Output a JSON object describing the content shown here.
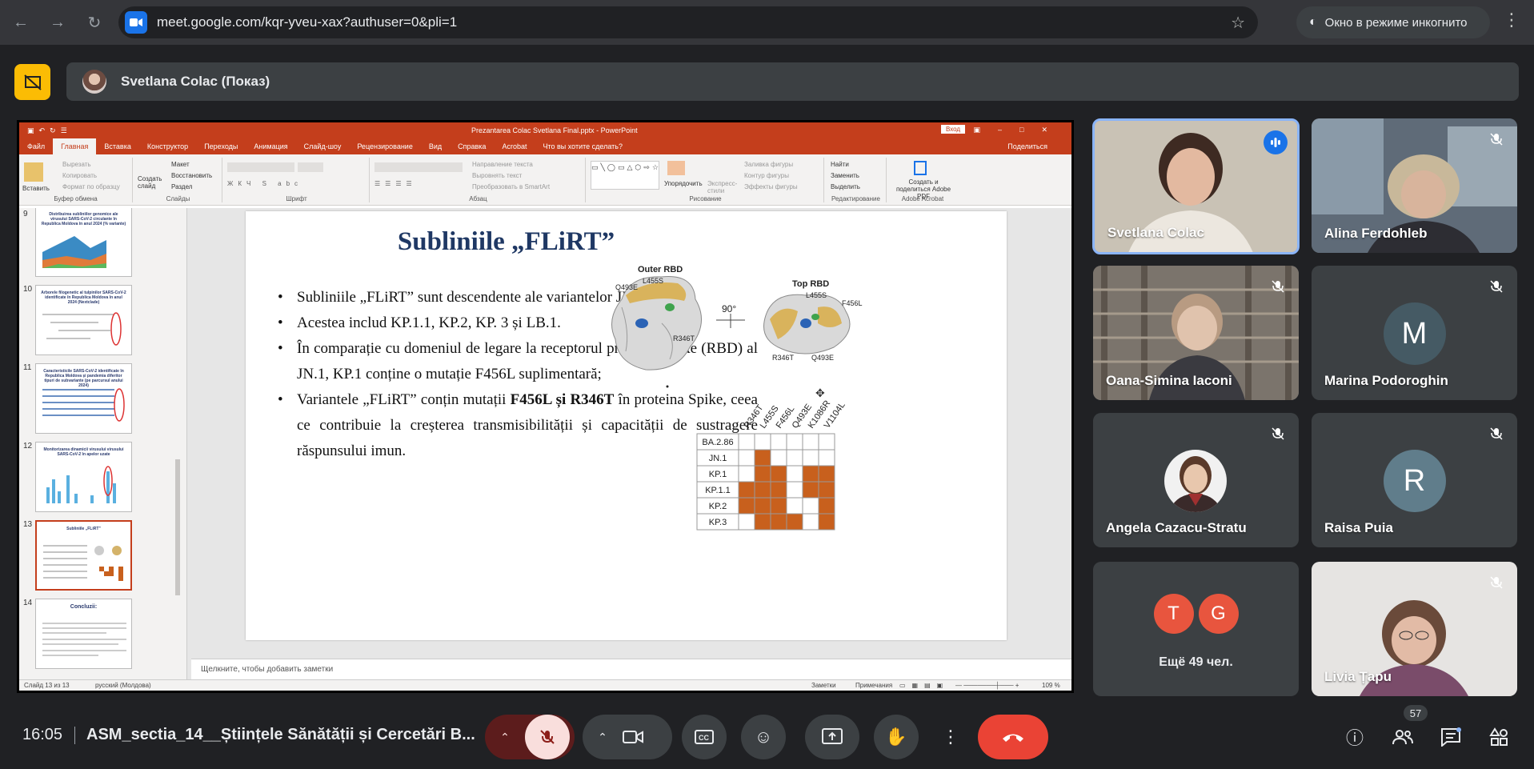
{
  "browser": {
    "url": "meet.google.com/kqr-yveu-xax?authuser=0&pli=1",
    "incognito_label": "Окно в режиме инкогнито"
  },
  "presenter": {
    "label": "Svetlana Colac (Показ)"
  },
  "ppt": {
    "doc_title": "Prezantarea Colac Svetlana Final.pptx - PowerPoint",
    "login_label": "Вход",
    "tabs": [
      "Файл",
      "Главная",
      "Вставка",
      "Конструктор",
      "Переходы",
      "Анимация",
      "Слайд-шоу",
      "Рецензирование",
      "Вид",
      "Справка",
      "Acrobat",
      "Что вы хотите сделать?"
    ],
    "share_label": "Поделиться",
    "groups": {
      "clipboard": {
        "label": "Буфер обмена",
        "paste": "Вставить",
        "cut": "Вырезать",
        "copy": "Копировать",
        "format": "Формат по образцу"
      },
      "slides": {
        "label": "Слайды",
        "create": "Создать слайд",
        "layout": "Макет",
        "reset": "Восстановить",
        "section": "Раздел"
      },
      "font": {
        "label": "Шрифт"
      },
      "paragraph": {
        "label": "Абзац",
        "direction": "Направление текста",
        "align": "Выровнять текст",
        "smartart": "Преобразовать в SmartArt"
      },
      "drawing": {
        "label": "Рисование",
        "arrange": "Упорядочить",
        "styles": "Экспресс-стили",
        "fill": "Заливка фигуры",
        "outline": "Контур фигуры",
        "effects": "Эффекты фигуры"
      },
      "editing": {
        "label": "Редактирование",
        "find": "Найти",
        "replace": "Заменить",
        "select": "Выделить"
      },
      "acrobat": {
        "label": "Adobe Acrobat",
        "create": "Создать и поделиться Adobe PDF"
      }
    },
    "thumbnails": [
      {
        "num": "9",
        "title": "Distribuirea subliniilor genomice ale virusului SARS-CoV-2 circulante în Republica Moldova în anul 2024 (% variante)"
      },
      {
        "num": "10",
        "title": "Arborele filogenetic al tulpinilor SARS-CoV-2 identificate în Republica Moldova în anul 2024 (Nextclade)"
      },
      {
        "num": "11",
        "title": "Caracteristicile SARS-CoV-2 identificate în Republica Moldova și pandemia diferitor tipuri de subvariante (pe parcursul anului 2024)"
      },
      {
        "num": "12",
        "title": "Monitorizarea dinamicii virusului virusului SARS-CoV-2 în apelor uzate"
      },
      {
        "num": "13",
        "title": "Subliniile „FLiRT”"
      },
      {
        "num": "14",
        "title": "Concluzii:"
      }
    ],
    "slide": {
      "title": "Subliniile „FLiRT”",
      "bullets": [
        {
          "text": "Subliniile „FLiRT” sunt descendente ale variantelor JN.1*."
        },
        {
          "text": "Acestea includ KP.1.1, KP.2, KP. 3 și LB.1."
        },
        {
          "text": "În comparație cu domeniul de legare la receptorul proteinei spike (RBD) al JN.1, KP.1 conține o mutație F456L suplimentară;"
        },
        {
          "pre": "Variantele „FLiRT” conțin mutații ",
          "bold": "F456L și R346T",
          "post": " în proteina Spike, ceea ce contribuie la creșterea transmisibilității și capacității de sustragere răspunsului imun."
        }
      ],
      "figure": {
        "outer_label": "Outer RBD",
        "top_label": "Top RBD",
        "rotation": "90°",
        "outer_marks": [
          "Q493E",
          "L455S",
          "R346T"
        ],
        "top_marks": [
          "L455S",
          "F456L",
          "R346T",
          "Q493E"
        ],
        "mutations": [
          "R346T",
          "L455S",
          "F456L",
          "Q493E",
          "K1086R",
          "V1104L"
        ],
        "variants": [
          "BA.2.86",
          "JN.1",
          "KP.1",
          "KP.1.1",
          "KP.2",
          "KP.3"
        ],
        "matrix": [
          [
            0,
            0,
            0,
            0,
            0,
            0
          ],
          [
            0,
            1,
            0,
            0,
            0,
            0
          ],
          [
            0,
            1,
            1,
            0,
            1,
            1
          ],
          [
            1,
            1,
            1,
            0,
            1,
            1
          ],
          [
            1,
            1,
            1,
            0,
            0,
            1
          ],
          [
            0,
            1,
            1,
            1,
            0,
            1
          ]
        ],
        "fill_color": "#c8601d"
      }
    },
    "notes_placeholder": "Щелкните, чтобы добавить заметки",
    "status": {
      "slide_of": "Слайд 13 из 13",
      "language": "русский (Молдова)",
      "notes": "Заметки",
      "comments": "Примечания",
      "zoom": "109 %"
    }
  },
  "participants": [
    {
      "name": "Svetlana Colac",
      "state": "speaking"
    },
    {
      "name": "Alina Ferdohleb",
      "state": "muted"
    },
    {
      "name": "Oana-Simina Iaconi",
      "state": "muted"
    },
    {
      "name": "Marina Podoroghin",
      "state": "muted",
      "initial": "M",
      "color": "#455a64"
    },
    {
      "name": "Angela Cazacu-Stratu",
      "state": "muted"
    },
    {
      "name": "Raisa Puia",
      "state": "muted",
      "initial": "R",
      "color": "#607d8b"
    },
    {
      "name": "Livia Țapu",
      "state": "muted"
    }
  ],
  "others": {
    "initials": [
      "T",
      "G"
    ],
    "color": "#e8553e",
    "label": "Ещё 49 чел."
  },
  "bottom": {
    "time": "16:05",
    "meeting_title": "ASM_sectia_14__Științele Sănătății și Cercetări B...",
    "participant_count": "57"
  },
  "colors": {
    "ppt_red": "#c43e1c",
    "meet_red": "#ea4335",
    "accent_blue": "#8ab4f8"
  }
}
